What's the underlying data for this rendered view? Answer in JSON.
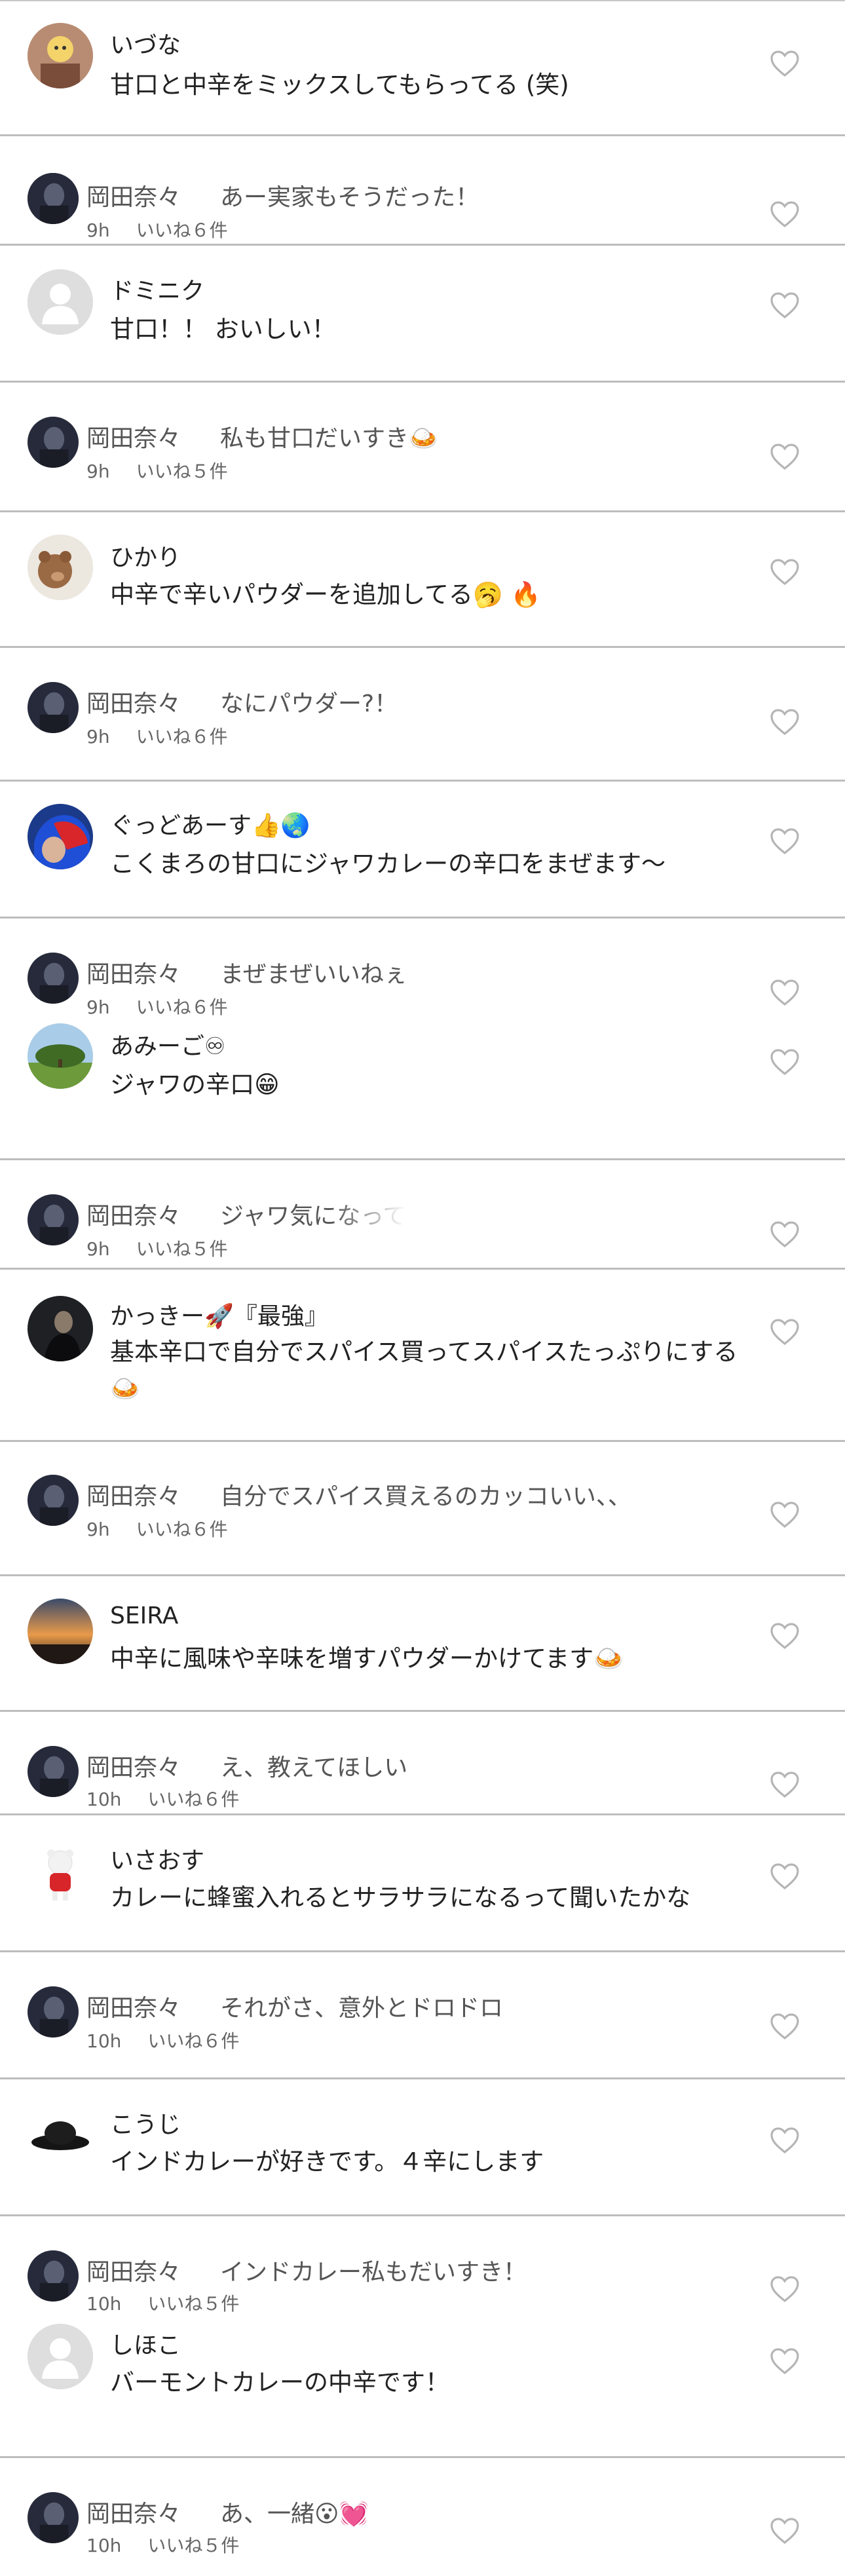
{
  "comments": [
    {
      "type": "comment",
      "name": "いづな",
      "text": "甘口と中辛をミックスしてもらってる (笑)",
      "avatar": "cartoon-avatar",
      "heart_icon": "heart-outline-icon",
      "replies": [
        {
          "name": "岡田奈々",
          "text": "あー実家もそうだった！",
          "time": "9h",
          "likes": "いいね６件",
          "avatar": "dark-portrait-avatar",
          "heart_icon": "heart-outline-icon"
        }
      ]
    },
    {
      "type": "comment",
      "name": "ドミニク",
      "text": "甘口！！ おいしい！",
      "avatar": "default-user-avatar",
      "heart_icon": "heart-outline-icon",
      "replies": [
        {
          "name": "岡田奈々",
          "text": "私も甘口だいすき🍛",
          "time": "9h",
          "likes": "いいね５件",
          "avatar": "dark-portrait-avatar",
          "heart_icon": "heart-outline-icon"
        }
      ]
    },
    {
      "type": "comment",
      "name": "ひかり",
      "text": "中辛で辛いパウダーを追加してる🥱 🔥",
      "avatar": "teddy-bear-avatar",
      "heart_icon": "heart-outline-icon",
      "replies": [
        {
          "name": "岡田奈々",
          "text": "なにパウダー?！",
          "time": "9h",
          "likes": "いいね６件",
          "avatar": "dark-portrait-avatar",
          "heart_icon": "heart-outline-icon"
        }
      ]
    },
    {
      "type": "comment",
      "name": "ぐっどあーす👍🌏",
      "text": "こくまろの甘口にジャワカレーの辛口をまぜます～",
      "avatar": "blue-red-hair-avatar",
      "heart_icon": "heart-outline-icon",
      "replies": [
        {
          "name": "岡田奈々",
          "text": "まぜまぜいいねぇ",
          "time": "9h",
          "likes": "いいね６件",
          "avatar": "dark-portrait-avatar",
          "heart_icon": "heart-outline-icon"
        },
        {
          "type": "comment",
          "name": "あみーご♾",
          "text": "ジャワの辛口😁",
          "avatar": "tree-landscape-avatar",
          "heart_icon": "heart-outline-icon"
        }
      ]
    },
    {
      "type": "comment-reply-only",
      "replies": [
        {
          "name": "岡田奈々",
          "text": "ジャワ気になって",
          "time": "9h",
          "likes": "いいね５件",
          "avatar": "dark-portrait-avatar",
          "heart_icon": "heart-outline-icon"
        }
      ]
    },
    {
      "type": "comment",
      "name": "かっきー🚀『最強』",
      "text": "基本辛口で自分でスパイス買ってスパイスたっぷりにする🍛",
      "avatar": "dark-person-avatar",
      "heart_icon": "heart-outline-icon",
      "replies": [
        {
          "name": "岡田奈々",
          "text": "自分でスパイス買えるのカッコいい、、",
          "time": "9h",
          "likes": "いいね６件",
          "avatar": "dark-portrait-avatar",
          "heart_icon": "heart-outline-icon"
        }
      ]
    },
    {
      "type": "comment",
      "name": "SEIRA",
      "text": "中辛に風味や辛味を増すパウダーかけてます🍛",
      "avatar": "sunset-avatar",
      "heart_icon": "heart-outline-icon",
      "replies": [
        {
          "name": "岡田奈々",
          "text": "え、教えてほしい",
          "time": "10h",
          "likes": "いいね６件",
          "avatar": "dark-portrait-avatar",
          "heart_icon": "heart-outline-icon"
        }
      ]
    },
    {
      "type": "comment",
      "name": "いさおす",
      "text": "カレーに蜂蜜入れるとサラサラになるって聞いたかな",
      "avatar": "white-bear-avatar",
      "heart_icon": "heart-outline-icon",
      "replies": [
        {
          "name": "岡田奈々",
          "text": "それがさ、意外とドロドロ",
          "time": "10h",
          "likes": "いいね６件",
          "avatar": "dark-portrait-avatar",
          "heart_icon": "heart-outline-icon"
        }
      ]
    },
    {
      "type": "comment",
      "name": "こうじ",
      "text": "インドカレーが好きです。４辛にします",
      "avatar": "black-hat-avatar",
      "heart_icon": "heart-outline-icon",
      "replies": [
        {
          "name": "岡田奈々",
          "text": "インドカレー私もだいすき！",
          "time": "10h",
          "likes": "いいね５件",
          "avatar": "dark-portrait-avatar",
          "heart_icon": "heart-outline-icon"
        },
        {
          "type": "comment",
          "name": "しほこ",
          "text": "バーモントカレーの中辛です！",
          "avatar": "default-user-avatar",
          "heart_icon": "heart-outline-icon"
        }
      ]
    },
    {
      "type": "comment-reply-only",
      "replies": [
        {
          "name": "岡田奈々",
          "text": "あ、一緒😮💓",
          "time": "10h",
          "likes": "いいね５件",
          "avatar": "dark-portrait-avatar",
          "heart_icon": "heart-outline-icon"
        }
      ]
    }
  ]
}
